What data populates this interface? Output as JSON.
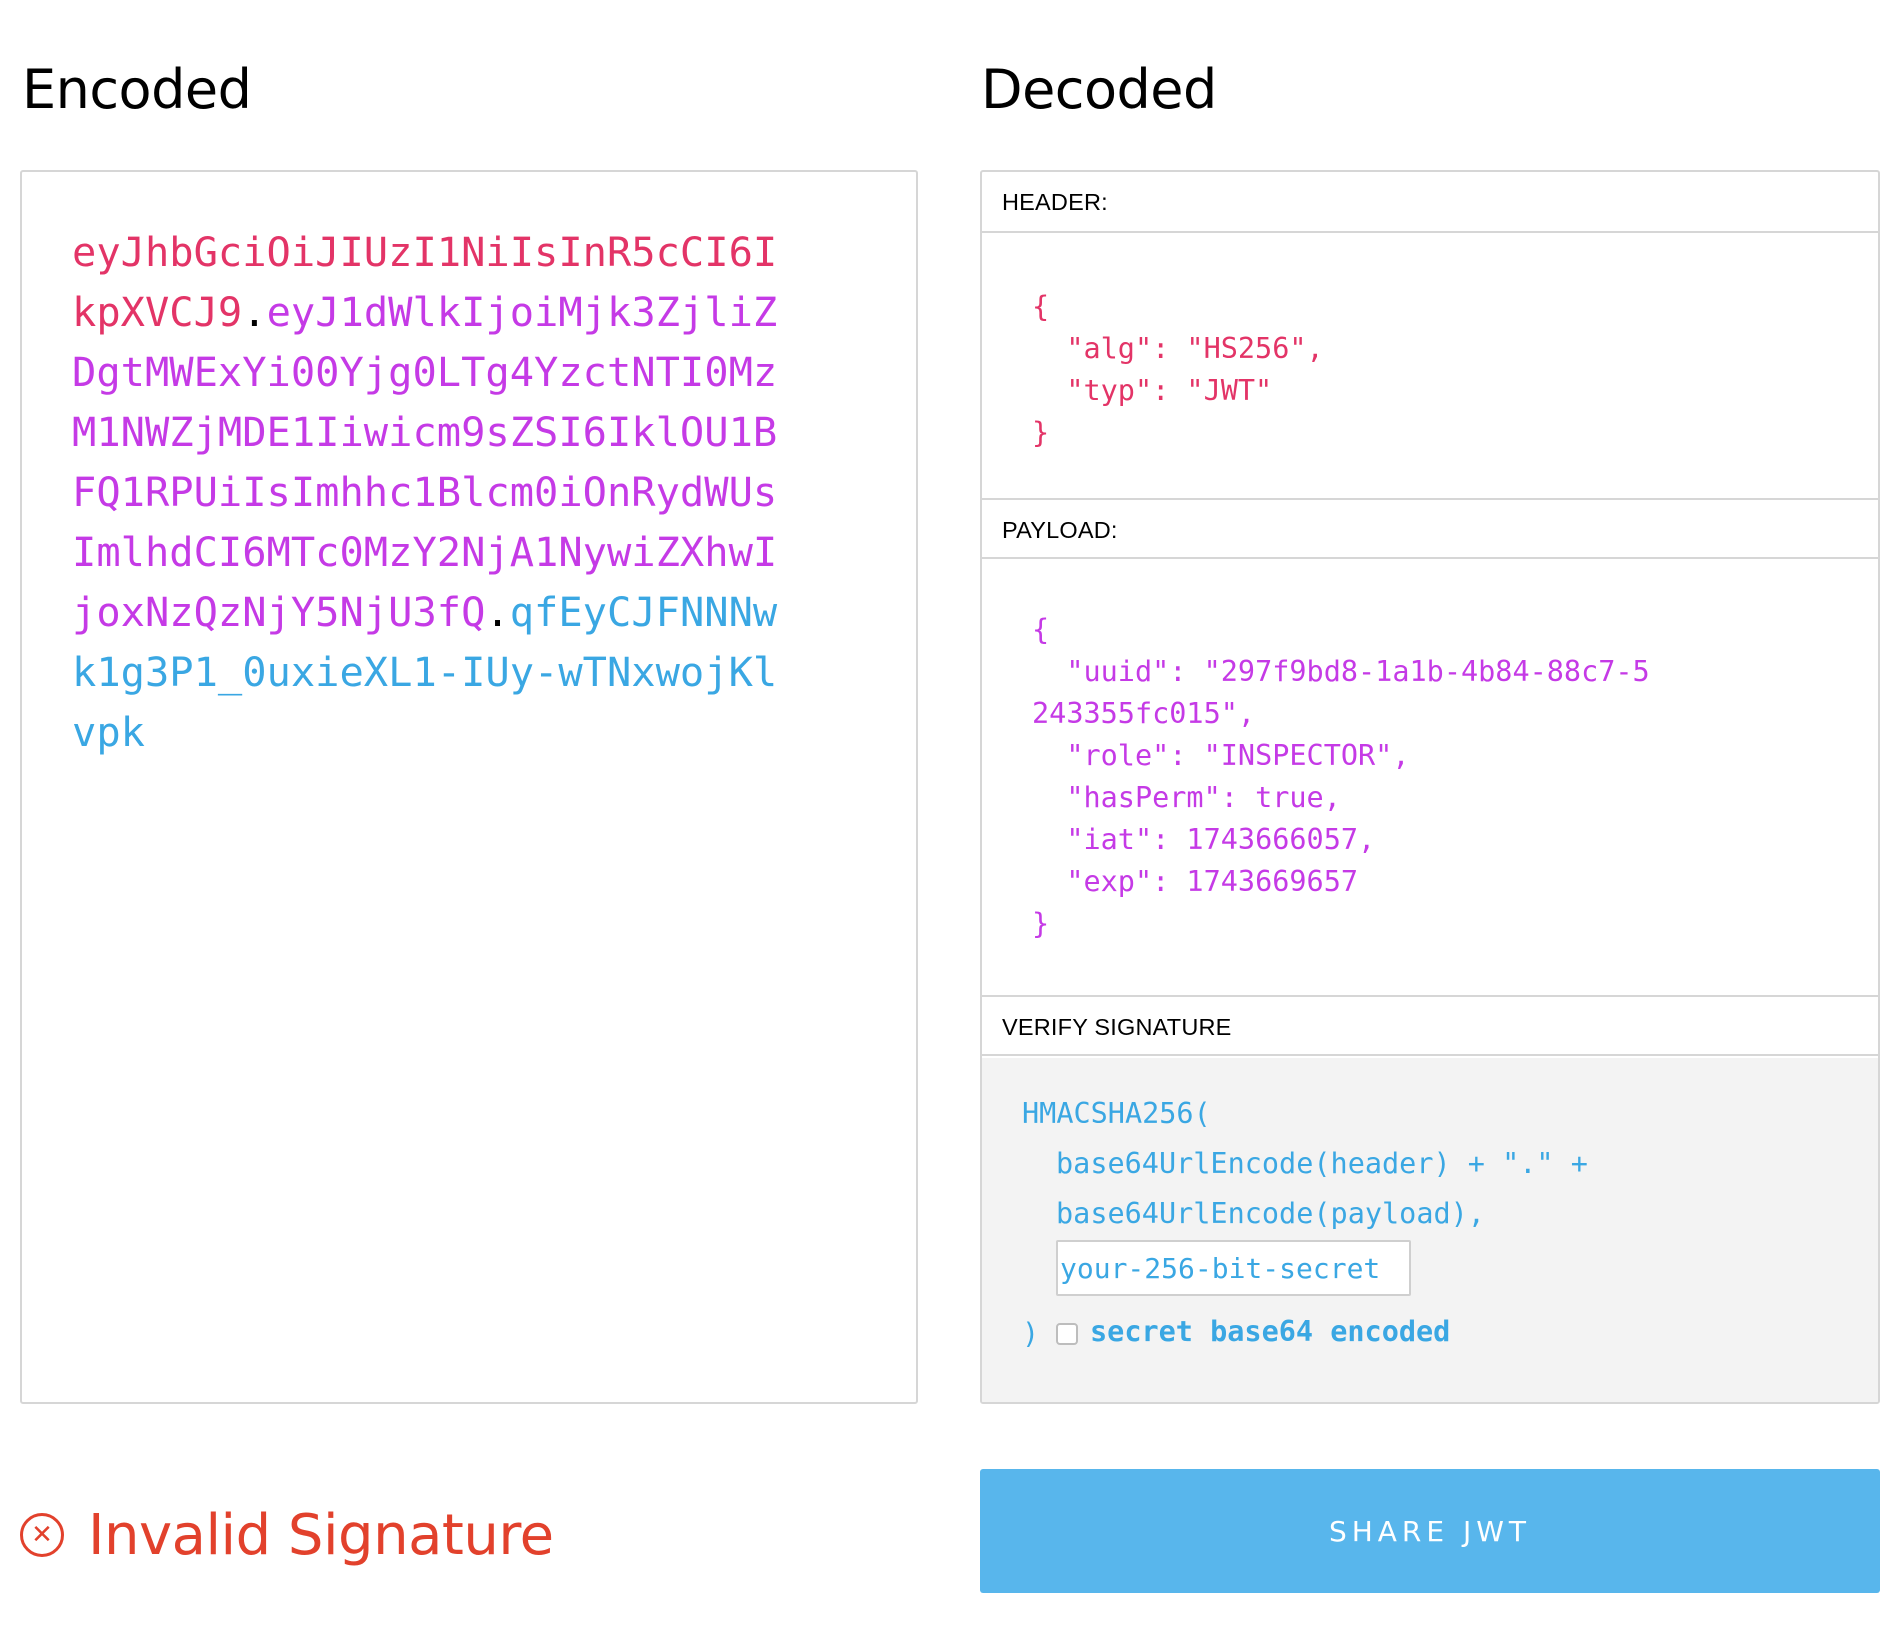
{
  "titles": {
    "encoded": "Encoded",
    "decoded": "Decoded"
  },
  "encoded": {
    "header": "eyJhbGciOiJIUzI1NiIsInR5cCI6IkpXVCJ9",
    "payload": "eyJ1dWlkIjoiMjk3ZjliZDgtMWExYi00Yjg0LTg4YzctNTI0MzM1NWZjMDE1Iiwicm9sZSI6IklOU1BFQ1RPUiIsImhhc1Blcm0iOnRydWUsImlhdCI6MTc0MzY2NjA1NywiZXhwIjoxNzQzNjY5NjU3fQ",
    "signature": "qfEyCJFNNNwk1g3P1_0uxieXL1-IUy-wTNxwojKlvpk",
    "separator": "."
  },
  "decoded": {
    "header_label": "HEADER:",
    "header_json": "{\n  \"alg\": \"HS256\",\n  \"typ\": \"JWT\"\n}",
    "payload_label": "PAYLOAD:",
    "payload_json": "{\n  \"uuid\": \"297f9bd8-1a1b-4b84-88c7-5243355fc015\",\n  \"role\": \"INSPECTOR\",\n  \"hasPerm\": true,\n  \"iat\": 1743666057,\n  \"exp\": 1743669657\n}",
    "verify_label": "VERIFY SIGNATURE",
    "verify": {
      "function": "HMACSHA256(",
      "line1": "base64UrlEncode(header) + \".\" +",
      "line2": "base64UrlEncode(payload),",
      "secret_placeholder": "your-256-bit-secret",
      "secret_value": "",
      "close": ")",
      "base64_label": "secret base64 encoded",
      "base64_checked": false
    }
  },
  "status": {
    "text": "Invalid Signature",
    "icon": "close-circle-icon",
    "color": "#e2412c"
  },
  "share_button": {
    "label": "SHARE JWT",
    "color": "#58b6ec"
  },
  "colors": {
    "header_token": "#e33467",
    "payload_token": "#c53ae6",
    "signature_token": "#3aa7e3"
  }
}
